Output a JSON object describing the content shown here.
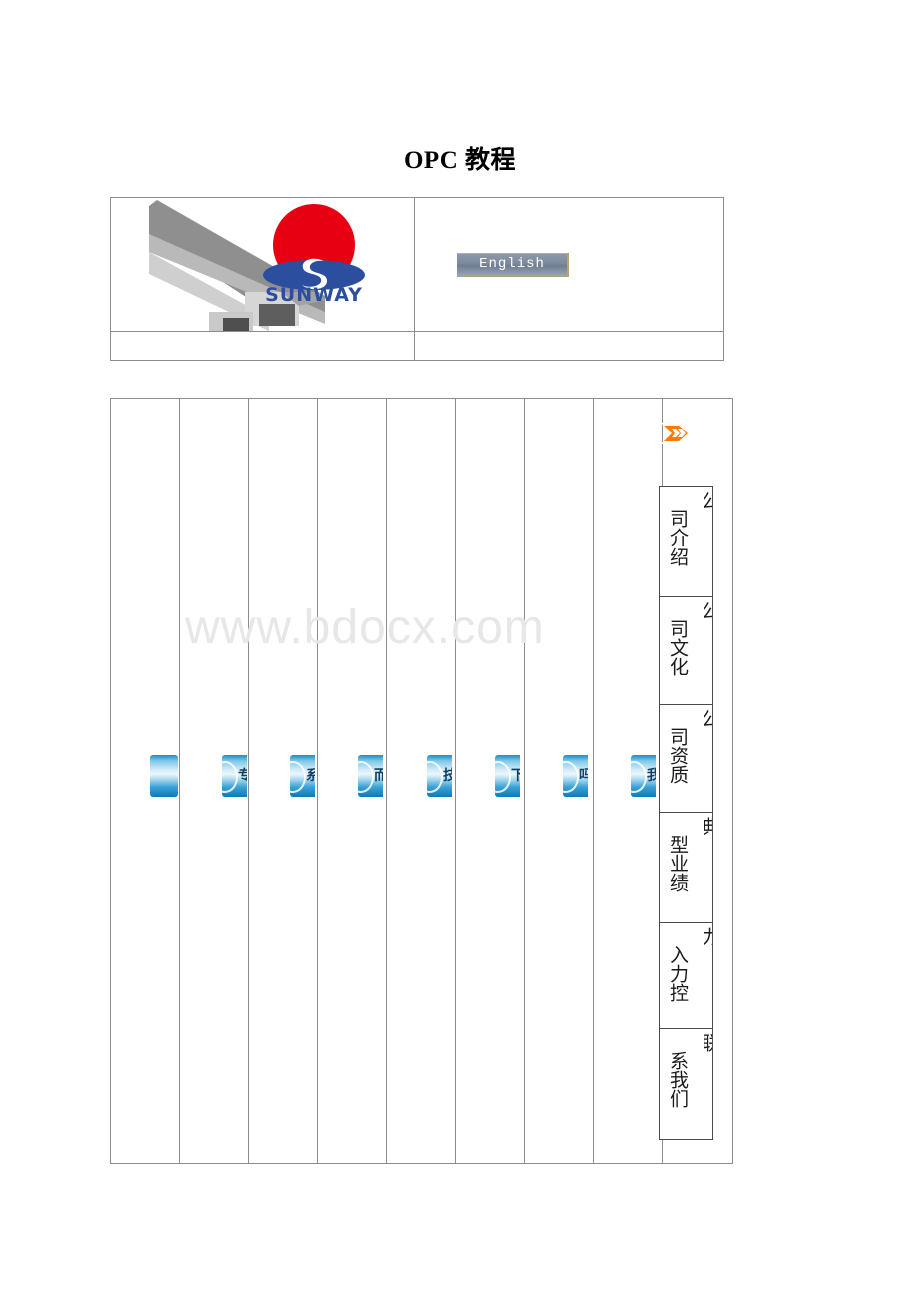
{
  "document": {
    "title": "OPC 教程",
    "watermark": "www.bdocx.com"
  },
  "header": {
    "logo": {
      "brand_text": "SUNWAY",
      "sun_color": "#e60012",
      "brand_color": "#2b4f9e",
      "alt": "sunway-logo"
    },
    "language_button": {
      "label": "English"
    }
  },
  "side_menu": {
    "arrow_icon": "double-chevron-right-icon",
    "arrow_color": "#ff7a00",
    "items": [
      {
        "visible_label": "司介绍",
        "clipped_char": "公"
      },
      {
        "visible_label": "司文化",
        "clipped_char": "公"
      },
      {
        "visible_label": "司资质",
        "clipped_char": "公"
      },
      {
        "visible_label": "型业绩",
        "clipped_char": "典"
      },
      {
        "visible_label": "入力控",
        "clipped_char": "力"
      },
      {
        "visible_label": "系我们",
        "clipped_char": "联"
      }
    ]
  },
  "nav_buttons": {
    "accent_color": "#1a8cc8",
    "items": [
      {
        "visible_label": ""
      },
      {
        "visible_label": "专"
      },
      {
        "visible_label": "系"
      },
      {
        "visible_label": "而"
      },
      {
        "visible_label": "技"
      },
      {
        "visible_label": "下"
      },
      {
        "visible_label": "吗"
      },
      {
        "visible_label": "我"
      }
    ]
  },
  "main_table": {
    "columns": 9,
    "rows": 1
  }
}
